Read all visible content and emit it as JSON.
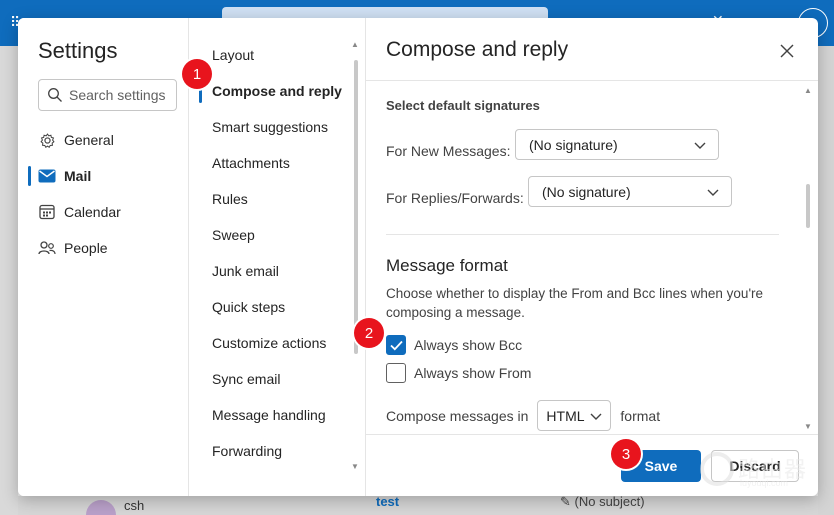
{
  "sidebar": {
    "title": "Settings",
    "search_placeholder": "Search settings",
    "categories": [
      {
        "label": "General",
        "icon": "gear-icon"
      },
      {
        "label": "Mail",
        "icon": "mail-icon",
        "active": true
      },
      {
        "label": "Calendar",
        "icon": "calendar-icon"
      },
      {
        "label": "People",
        "icon": "people-icon"
      }
    ]
  },
  "submenu": {
    "items": [
      {
        "label": "Layout"
      },
      {
        "label": "Compose and reply",
        "active": true
      },
      {
        "label": "Smart suggestions"
      },
      {
        "label": "Attachments"
      },
      {
        "label": "Rules"
      },
      {
        "label": "Sweep"
      },
      {
        "label": "Junk email"
      },
      {
        "label": "Quick steps"
      },
      {
        "label": "Customize actions"
      },
      {
        "label": "Sync email"
      },
      {
        "label": "Message handling"
      },
      {
        "label": "Forwarding"
      }
    ]
  },
  "content": {
    "title": "Compose and reply",
    "signatures": {
      "heading": "Select default signatures",
      "new_label": "For New Messages:",
      "new_value": "(No signature)",
      "reply_label": "For Replies/Forwards:",
      "reply_value": "(No signature)"
    },
    "message_format": {
      "heading": "Message format",
      "description": "Choose whether to display the From and Bcc lines when you're composing a message.",
      "bcc_label": "Always show Bcc",
      "bcc_checked": true,
      "from_label": "Always show From",
      "from_checked": false,
      "compose_prefix": "Compose messages in",
      "compose_value": "HTML",
      "compose_suffix": "format"
    }
  },
  "footer": {
    "save_label": "Save",
    "discard_label": "Discard"
  },
  "badges": [
    "1",
    "2",
    "3"
  ],
  "background": {
    "list_sender": "csh",
    "list_subject": "test",
    "draft_subject": "(No subject)"
  },
  "watermark": {
    "text": "路由器",
    "sub": "luyouqi.com"
  },
  "colors": {
    "accent": "#0f6cbd",
    "badge": "#e8141d"
  }
}
